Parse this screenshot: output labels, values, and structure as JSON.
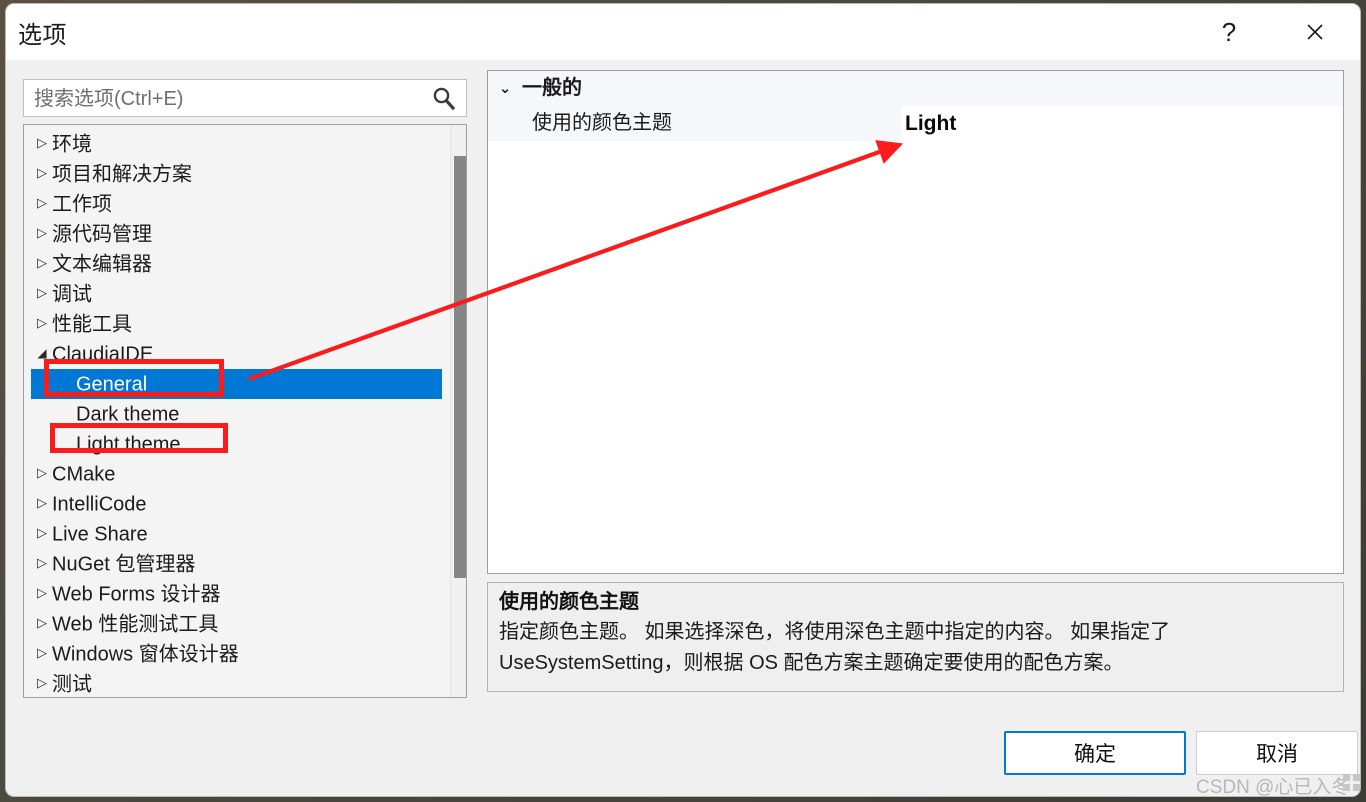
{
  "window": {
    "title": "选项",
    "help_label": "?",
    "close_label": "✕"
  },
  "search": {
    "placeholder": "搜索选项(Ctrl+E)",
    "value": "",
    "icon": "search-icon"
  },
  "tree": {
    "items": [
      {
        "label": "环境",
        "state": "collapsed",
        "level": 0
      },
      {
        "label": "项目和解决方案",
        "state": "collapsed",
        "level": 0
      },
      {
        "label": "工作项",
        "state": "collapsed",
        "level": 0
      },
      {
        "label": "源代码管理",
        "state": "collapsed",
        "level": 0
      },
      {
        "label": "文本编辑器",
        "state": "collapsed",
        "level": 0
      },
      {
        "label": "调试",
        "state": "collapsed",
        "level": 0
      },
      {
        "label": "性能工具",
        "state": "collapsed",
        "level": 0
      },
      {
        "label": "ClaudiaIDE",
        "state": "expanded",
        "level": 0
      },
      {
        "label": "General",
        "state": "leaf",
        "level": 1,
        "selected": true
      },
      {
        "label": "Dark theme",
        "state": "leaf",
        "level": 1
      },
      {
        "label": "Light theme",
        "state": "leaf",
        "level": 1
      },
      {
        "label": "CMake",
        "state": "collapsed",
        "level": 0
      },
      {
        "label": "IntelliCode",
        "state": "collapsed",
        "level": 0
      },
      {
        "label": "Live Share",
        "state": "collapsed",
        "level": 0
      },
      {
        "label": "NuGet 包管理器",
        "state": "collapsed",
        "level": 0
      },
      {
        "label": "Web Forms 设计器",
        "state": "collapsed",
        "level": 0
      },
      {
        "label": "Web 性能测试工具",
        "state": "collapsed",
        "level": 0
      },
      {
        "label": "Windows 窗体设计器",
        "state": "collapsed",
        "level": 0
      },
      {
        "label": "测试",
        "state": "collapsed",
        "level": 0
      }
    ],
    "collapsed_glyph": "▷",
    "expanded_glyph": "◢"
  },
  "property_grid": {
    "category": {
      "label": "一般的",
      "twisty": "⌄"
    },
    "rows": [
      {
        "name": "使用的颜色主题",
        "value": "Light"
      }
    ]
  },
  "description": {
    "title": "使用的颜色主题",
    "body": "指定颜色主题。 如果选择深色，将使用深色主题中指定的内容。 如果指定了 UseSystemSetting，则根据 OS 配色方案主题确定要使用的配色方案。"
  },
  "footer": {
    "ok_label": "确定",
    "cancel_label": "取消"
  },
  "annotations": {
    "box_general": "General",
    "box_light_theme": "Light theme",
    "arrow": "arrow pointing from General tree item to Light value",
    "accent_red": "#FA1C1C",
    "accent_blue": "#0078D4"
  },
  "watermark": {
    "text": "CSDN @心已入冬"
  }
}
